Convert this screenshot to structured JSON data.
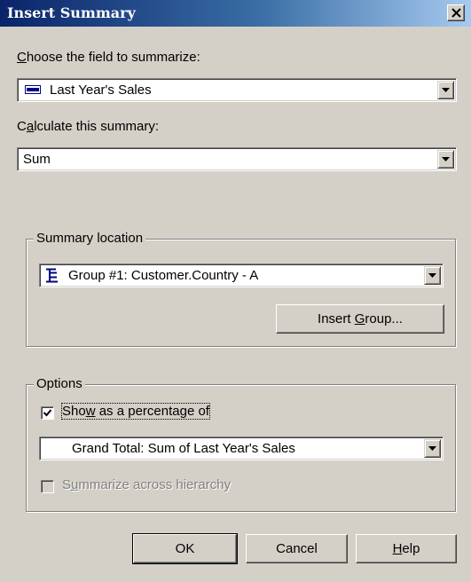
{
  "window": {
    "title": "Insert Summary",
    "close_label": "×"
  },
  "field": {
    "label_mn": "C",
    "label_rest": "hoose the field to summarize:",
    "value": "Last Year's Sales",
    "icon": "database-field-icon"
  },
  "calc": {
    "label_pre": "C",
    "label_mn": "a",
    "label_rest": "lculate this summary:",
    "value": "Sum"
  },
  "location": {
    "group_title": "Summary location",
    "value": "Group #1: Customer.Country - A",
    "icon": "group-tree-icon",
    "insert_group_pre": "Insert ",
    "insert_group_mn": "G",
    "insert_group_rest": "roup..."
  },
  "options": {
    "group_title": "Options",
    "show_pct_pre": "Sho",
    "show_pct_mn": "w",
    "show_pct_rest": " as a percentage of",
    "show_pct_checked": true,
    "pct_value": "Grand Total: Sum of Last Year's Sales",
    "across_pre": "S",
    "across_mn": "u",
    "across_rest": "mmarize across hierarchy",
    "across_checked": false,
    "across_enabled": false
  },
  "buttons": {
    "ok": "OK",
    "cancel": "Cancel",
    "help_mn": "H",
    "help_rest": "elp"
  }
}
